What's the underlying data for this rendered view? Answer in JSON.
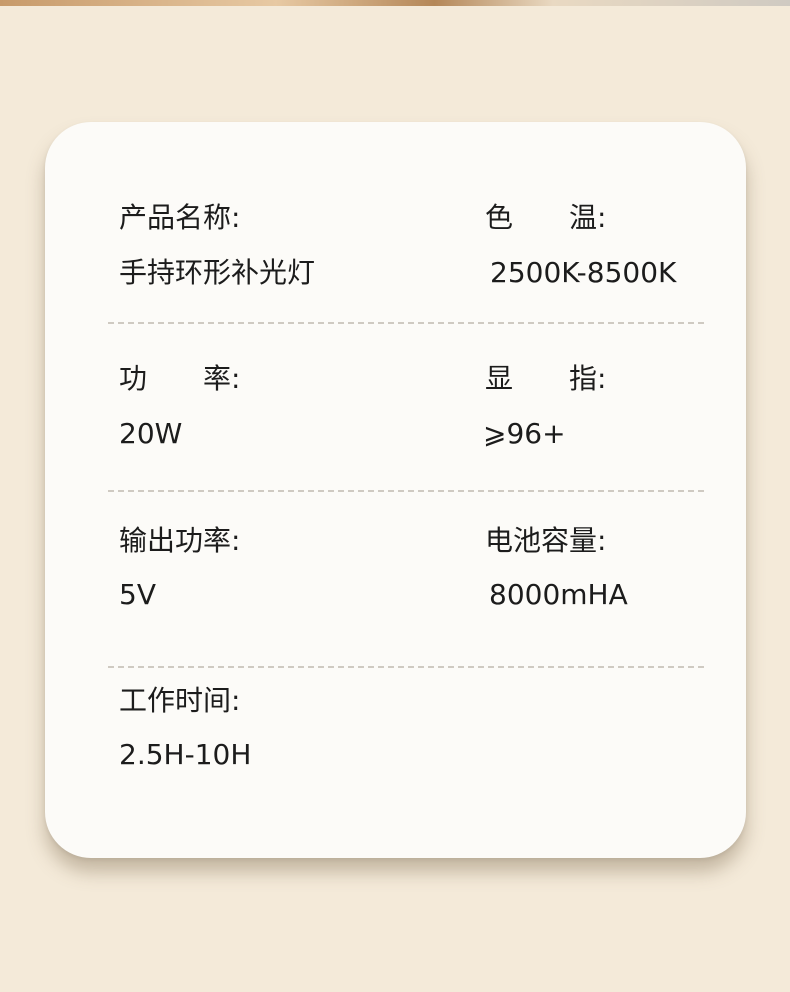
{
  "specs": [
    {
      "label": "产品名称:",
      "value": "手持环形补光灯"
    },
    {
      "label": "色　　温:",
      "value": "2500K-8500K"
    },
    {
      "label": "功　　率:",
      "value": "20W"
    },
    {
      "label": "显　　指:",
      "value": "⩾96+"
    },
    {
      "label": "输出功率:",
      "value": "5V"
    },
    {
      "label": "电池容量:",
      "value": "8000mHA"
    },
    {
      "label": "工作时间:",
      "value": "2.5H-10H"
    }
  ],
  "colors": {
    "background": "#f4ead9",
    "card": "#fcfbf8",
    "text": "#1c1c1c",
    "divider": "#cfcac2"
  }
}
